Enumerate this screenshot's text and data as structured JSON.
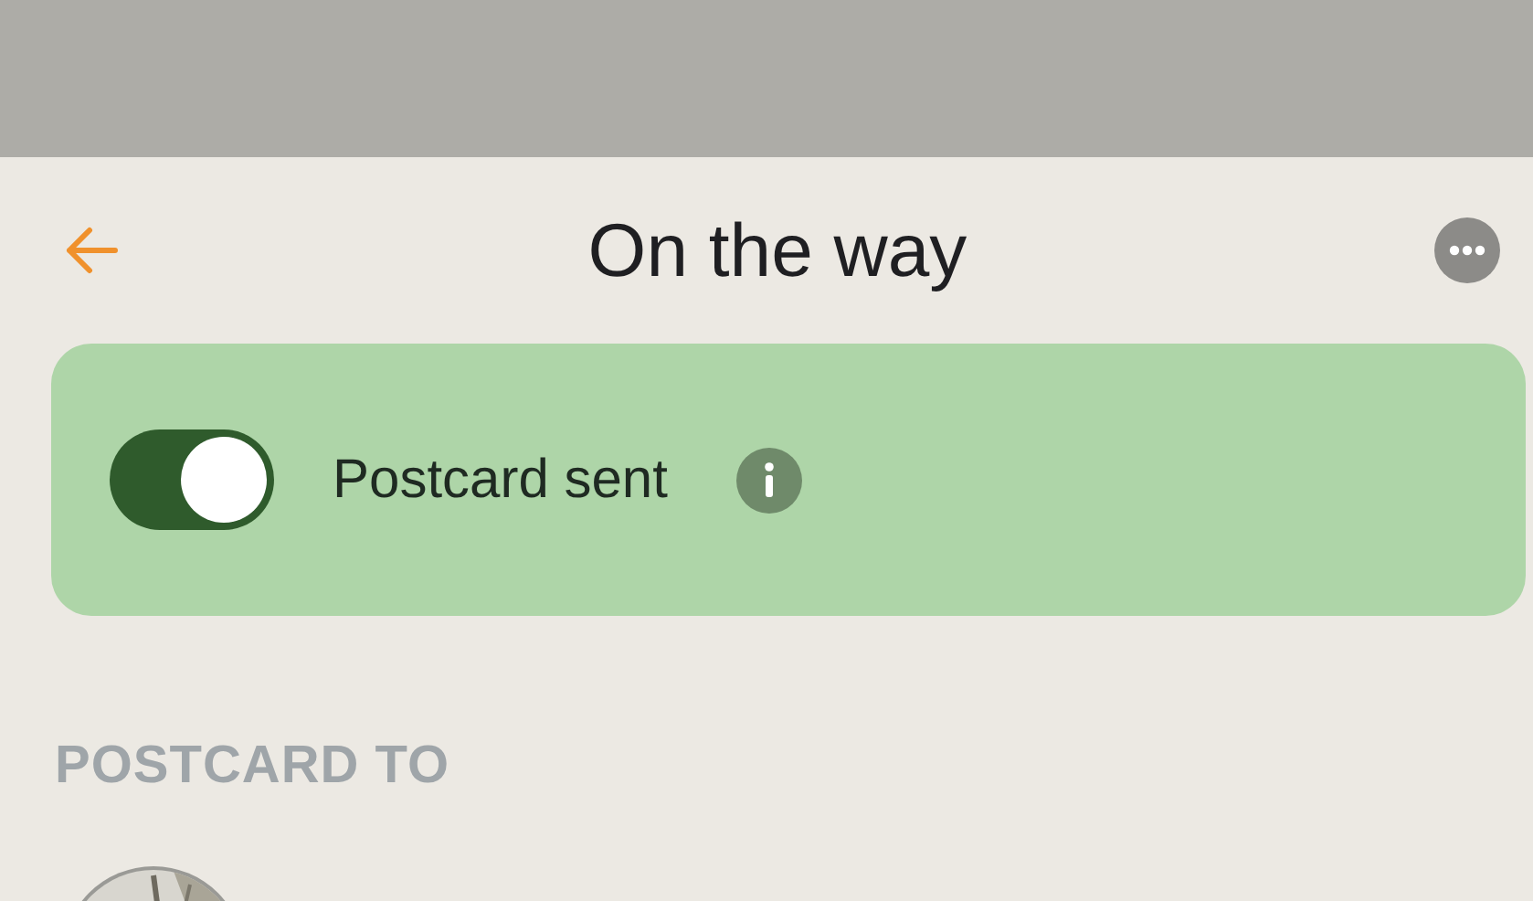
{
  "header": {
    "title": "On the way"
  },
  "postcard_sent": {
    "label": "Postcard sent",
    "on": true
  },
  "section": {
    "heading": "POSTCARD TO"
  }
}
